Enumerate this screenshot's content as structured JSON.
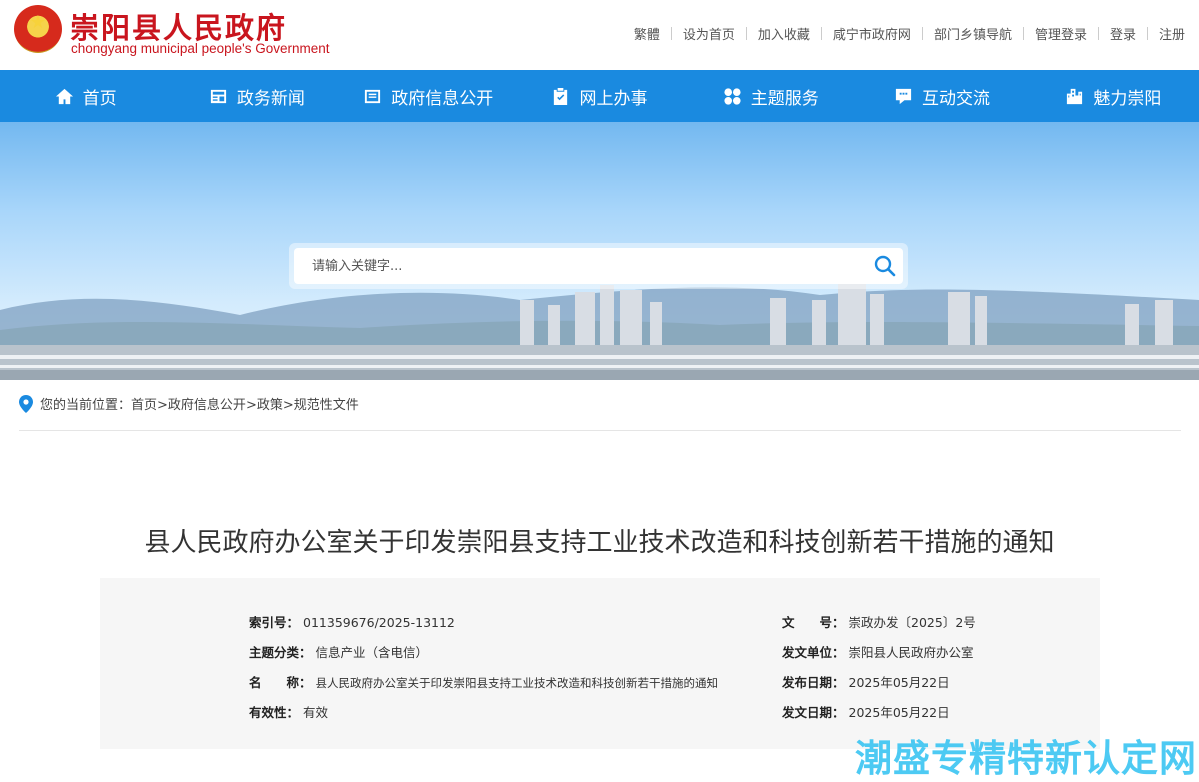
{
  "header": {
    "logo_cn": "崇阳县人民政府",
    "logo_en": "chongyang municipal people's Government",
    "links": [
      "繁體",
      "设为首页",
      "加入收藏",
      "咸宁市政府网",
      "部门乡镇导航",
      "管理登录",
      "登录",
      "注册"
    ]
  },
  "nav": {
    "items": [
      {
        "label": "首页",
        "icon": "home-icon"
      },
      {
        "label": "政务新闻",
        "icon": "news-icon"
      },
      {
        "label": "政府信息公开",
        "icon": "document-icon"
      },
      {
        "label": "网上办事",
        "icon": "clipboard-check-icon"
      },
      {
        "label": "主题服务",
        "icon": "grid-icon"
      },
      {
        "label": "互动交流",
        "icon": "chat-icon"
      },
      {
        "label": "魅力崇阳",
        "icon": "city-icon"
      }
    ],
    "bg_color": "#1a8ae0"
  },
  "search": {
    "placeholder": "请输入关键字..."
  },
  "breadcrumb": {
    "prefix": "您的当前位置：",
    "items": [
      "首页",
      ">政府信息公开",
      ">政策",
      ">规范性文件"
    ]
  },
  "article": {
    "title": "县人民政府办公室关于印发崇阳县支持工业技术改造和科技创新若干措施的通知",
    "meta": {
      "index_label": "索引号：",
      "index_value": "011359676/2025-13112",
      "docno_label": "文　　号：",
      "docno_value": "崇政办发〔2025〕2号",
      "topic_label": "主题分类：",
      "topic_value": "信息产业（含电信）",
      "issuer_label": "发文单位：",
      "issuer_value": "崇阳县人民政府办公室",
      "name_label": "名　　称：",
      "name_value": "县人民政府办公室关于印发崇阳县支持工业技术改造和科技创新若干措施的通知",
      "pubdate_label": "发布日期：",
      "pubdate_value": "2025年05月22日",
      "validity_label": "有效性：",
      "validity_value": "有效",
      "issuedate_label": "发文日期：",
      "issuedate_value": "2025年05月22日"
    }
  },
  "watermark": "潮盛专精特新认定网",
  "colors": {
    "brand_red": "#c9151e",
    "nav_blue": "#1a8ae0",
    "watermark": "#3ec6f2"
  }
}
